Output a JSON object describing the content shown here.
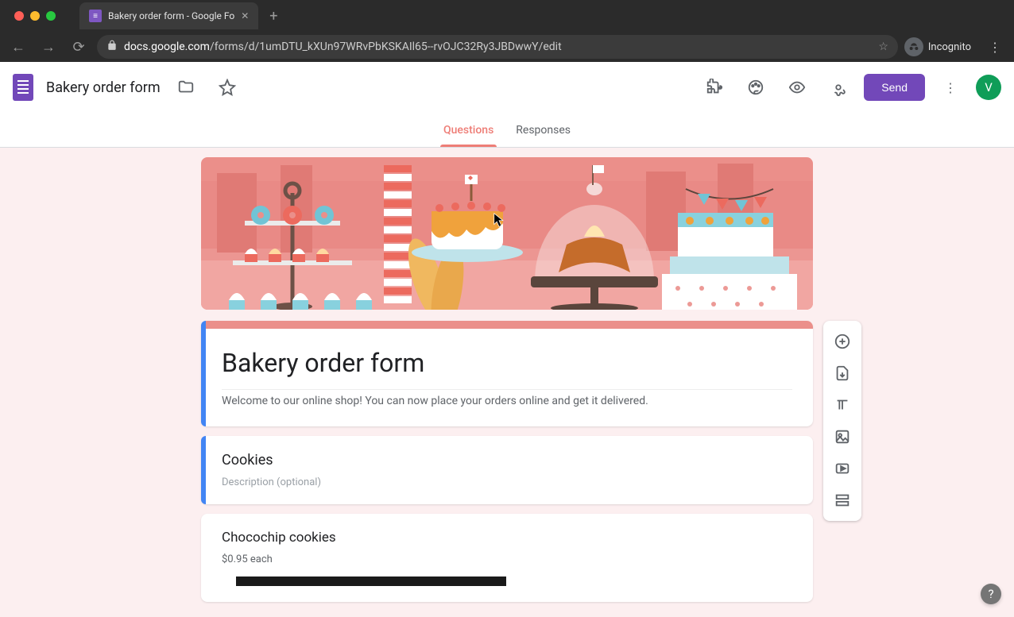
{
  "browser": {
    "tab_title": "Bakery order form - Google Fo",
    "url_prefix": "docs.google.com",
    "url_path": "/forms/d/1umDTU_kXUn97WRvPbKSKAIl65--rvOJC32Ry3JBDwwY/edit",
    "incognito_label": "Incognito"
  },
  "header": {
    "doc_title": "Bakery order form",
    "send_label": "Send",
    "avatar_letter": "V"
  },
  "tabs": {
    "questions": "Questions",
    "responses": "Responses"
  },
  "form": {
    "title": "Bakery order form",
    "description": "Welcome to our online shop! You can now place your orders online and get it delivered.",
    "section": {
      "title": "Cookies",
      "desc_placeholder": "Description (optional)"
    },
    "question1": {
      "title": "Chocochip cookies",
      "price": "$0.95 each"
    }
  },
  "side": {
    "add_question": "Add question",
    "import_questions": "Import questions",
    "add_title": "Add title and description",
    "add_image": "Add image",
    "add_video": "Add video",
    "add_section": "Add section"
  },
  "colors": {
    "accent": "#eb8f8a",
    "primary": "#7248b9",
    "canvas_bg": "#fceff0"
  }
}
